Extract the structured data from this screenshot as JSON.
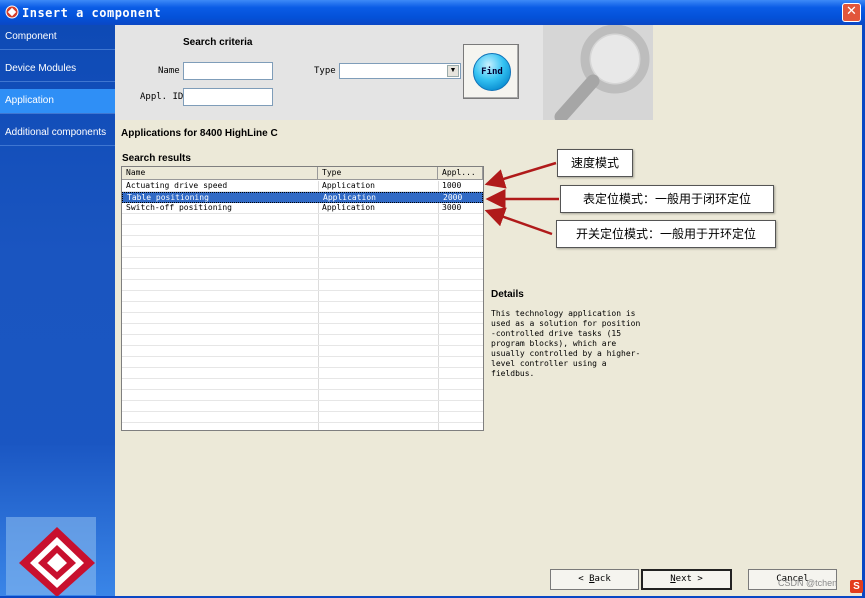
{
  "window": {
    "title": "Insert a component",
    "close_glyph": "✕"
  },
  "sidebar": {
    "items": [
      {
        "label": "Component",
        "active": false
      },
      {
        "label": "Device Modules",
        "active": false
      },
      {
        "label": "Application",
        "active": true
      },
      {
        "label": "Additional components",
        "active": false
      }
    ],
    "logo_icon": "lenze-diamond-logo-icon"
  },
  "search_criteria": {
    "title": "Search criteria",
    "name_label": "Name",
    "name_value": "",
    "type_label": "Type",
    "type_value": "",
    "appl_id_label": "Appl. ID",
    "appl_id_value": "",
    "find_label": "Find",
    "banner_icon": "magnifier-icon"
  },
  "applications_heading": "Applications for 8400 HighLine C",
  "search_results": {
    "title": "Search results",
    "columns": [
      "Name",
      "Type",
      "Appl..."
    ],
    "rows": [
      {
        "name": "Actuating drive speed",
        "type": "Application",
        "appl": "1000",
        "selected": false
      },
      {
        "name": "Table positioning",
        "type": "Application",
        "appl": "2000",
        "selected": true
      },
      {
        "name": "Switch-off positioning",
        "type": "Application",
        "appl": "3000",
        "selected": false
      }
    ]
  },
  "details": {
    "title": "Details",
    "text": "This technology application is\nused as a solution for position\n-controlled drive tasks (15\nprogram blocks), which are\nusually controlled by a higher-\nlevel controller using a\nfieldbus."
  },
  "annotations": [
    {
      "text": "速度模式"
    },
    {
      "text": "表定位模式：一般用于闭环定位"
    },
    {
      "text": "开关定位模式：一般用于开环定位"
    }
  ],
  "buttons": {
    "back": {
      "prefix": "< ",
      "mnemonic": "B",
      "rest": "ack"
    },
    "next": {
      "mnemonic": "N",
      "rest": "ext",
      "suffix": " >"
    },
    "cancel": "Cancel"
  },
  "watermark": "CSDN @tchen",
  "brand_badge": "S",
  "colors": {
    "titlebar": "#0a5ce6",
    "sidebar": "#1a55c0",
    "sidebar_active": "#2f8ff6",
    "selection": "#316ac5",
    "arrow": "#b01a1a"
  }
}
